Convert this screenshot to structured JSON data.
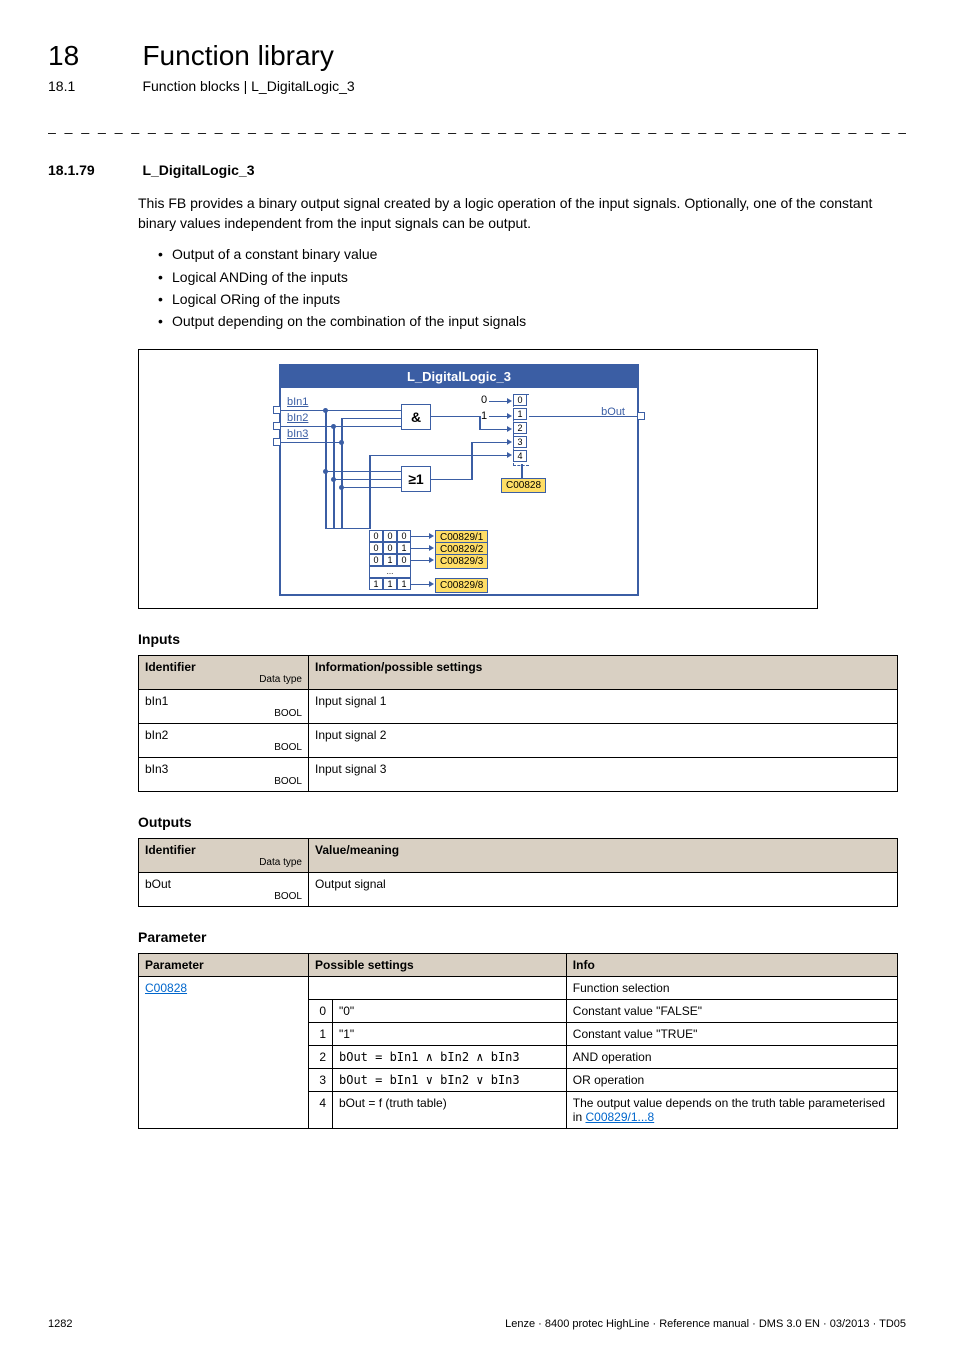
{
  "header": {
    "chapter_num": "18",
    "chapter_title": "Function library",
    "section_num": "18.1",
    "section_title": "Function blocks | L_DigitalLogic_3"
  },
  "sec": {
    "num": "18.1.79",
    "title": "L_DigitalLogic_3"
  },
  "body": "This FB provides a binary output signal created by a logic operation of the input signals. Optionally, one of the constant binary values independent from the input signals can be output.",
  "bullets": [
    "Output of a constant binary value",
    "Logical ANDing of the inputs",
    "Logical ORing of the inputs",
    "Output depending on the combination of the input signals"
  ],
  "diagram": {
    "title": "L_DigitalLogic_3",
    "inputs": [
      "bIn1",
      "bIn2",
      "bIn3"
    ],
    "and_symbol": "&",
    "or_symbol": "≥1",
    "const0": "0",
    "const1": "1",
    "mux_slots": [
      "0",
      "1",
      "2",
      "3",
      "4"
    ],
    "mux_param": "C00828",
    "truth_bits": [
      [
        "0",
        "0",
        "0"
      ],
      [
        "0",
        "0",
        "1"
      ],
      [
        "0",
        "1",
        "0"
      ],
      [
        "...",
        "",
        ""
      ],
      [
        "1",
        "1",
        "1"
      ]
    ],
    "truth_params": [
      "C00829/1",
      "C00829/2",
      "C00829/3",
      "C00829/8"
    ],
    "output": "bOut"
  },
  "inputs_table": {
    "heading": "Inputs",
    "col1": "Identifier",
    "col1_sub": "Data type",
    "col2": "Information/possible settings",
    "rows": [
      {
        "id": "bIn1",
        "dt": "BOOL",
        "info": "Input signal 1"
      },
      {
        "id": "bIn2",
        "dt": "BOOL",
        "info": "Input signal 2"
      },
      {
        "id": "bIn3",
        "dt": "BOOL",
        "info": "Input signal 3"
      }
    ]
  },
  "outputs_table": {
    "heading": "Outputs",
    "col1": "Identifier",
    "col1_sub": "Data type",
    "col2": "Value/meaning",
    "rows": [
      {
        "id": "bOut",
        "dt": "BOOL",
        "info": "Output signal"
      }
    ]
  },
  "param_table": {
    "heading": "Parameter",
    "col1": "Parameter",
    "col2": "Possible settings",
    "col3": "Info",
    "param_link": "C00828",
    "info0": "Function selection",
    "rows": [
      {
        "n": "0",
        "ps": "\"0\"",
        "info": "Constant value \"FALSE\""
      },
      {
        "n": "1",
        "ps": "\"1\"",
        "info": "Constant value \"TRUE\""
      },
      {
        "n": "2",
        "ps": "bOut = bIn1 ∧ bIn2 ∧ bIn3",
        "info": "AND operation"
      },
      {
        "n": "3",
        "ps": "bOut = bIn1 ∨ bIn2 ∨ bIn3",
        "info": "OR operation"
      },
      {
        "n": "4",
        "ps": "bOut = f (truth table)",
        "info": "The output value depends on the truth table parameterised in ",
        "link": "C00829/1...8"
      }
    ]
  },
  "footer": {
    "page": "1282",
    "text": "Lenze · 8400 protec HighLine · Reference manual · DMS 3.0 EN · 03/2013 · TD05"
  },
  "dashes": "_ _ _ _ _ _ _ _ _ _ _ _ _ _ _ _ _ _ _ _ _ _ _ _ _ _ _ _ _ _ _ _ _ _ _ _ _ _ _ _ _ _ _ _ _ _ _ _ _ _ _ _ _ _ _ _ _ _ _ _ _ _ _ _"
}
